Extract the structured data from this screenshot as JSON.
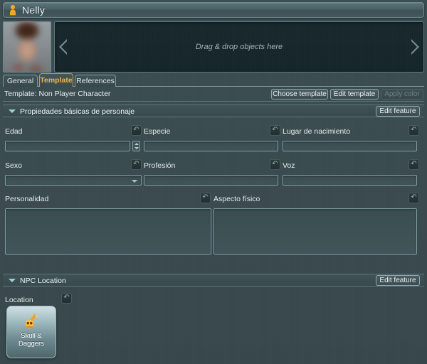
{
  "window": {
    "title": "Nelly",
    "title_icon": "character-pawn-icon"
  },
  "header": {
    "portrait_alt": "character-portrait",
    "dropzone_text": "Drag & drop objects here",
    "prev_icon": "chevron-left-icon",
    "next_icon": "chevron-right-icon"
  },
  "tabs": [
    {
      "label": "General",
      "active": false
    },
    {
      "label": "Template",
      "active": true
    },
    {
      "label": "References",
      "active": false
    }
  ],
  "template_bar": {
    "label": "Template: Non Player Character",
    "buttons": [
      {
        "label": "Choose template",
        "enabled": true
      },
      {
        "label": "Edit template",
        "enabled": true
      },
      {
        "label": "Apply color",
        "enabled": false
      }
    ]
  },
  "sections": [
    {
      "title": "Propiedades básicas de personaje",
      "collapse_icon": "chevron-down-icon",
      "edit_label": "Edit feature",
      "fields": [
        {
          "label": "Edad",
          "value": "",
          "type": "spinner"
        },
        {
          "label": "Especie",
          "value": "",
          "type": "text"
        },
        {
          "label": "Lugar de nacimiento",
          "value": "",
          "type": "text"
        },
        {
          "label": "Sexo",
          "value": "",
          "type": "dropdown"
        },
        {
          "label": "Profesión",
          "value": "",
          "type": "text"
        },
        {
          "label": "Voz",
          "value": "",
          "type": "text"
        },
        {
          "label": "Personalidad",
          "value": "",
          "type": "textarea"
        },
        {
          "label": "Aspecto físico",
          "value": "",
          "type": "textarea"
        }
      ]
    },
    {
      "title": "NPC Location",
      "collapse_icon": "chevron-down-icon",
      "edit_label": "Edit feature",
      "location_label": "Location",
      "card": {
        "label": "Skull & Daggers",
        "icon": "skull-and-daggers-icon"
      }
    }
  ],
  "colors": {
    "background": "#3a4a4e",
    "accent": "#e8b552",
    "border": "#7fa0a6",
    "dropzone": "#18282c"
  }
}
